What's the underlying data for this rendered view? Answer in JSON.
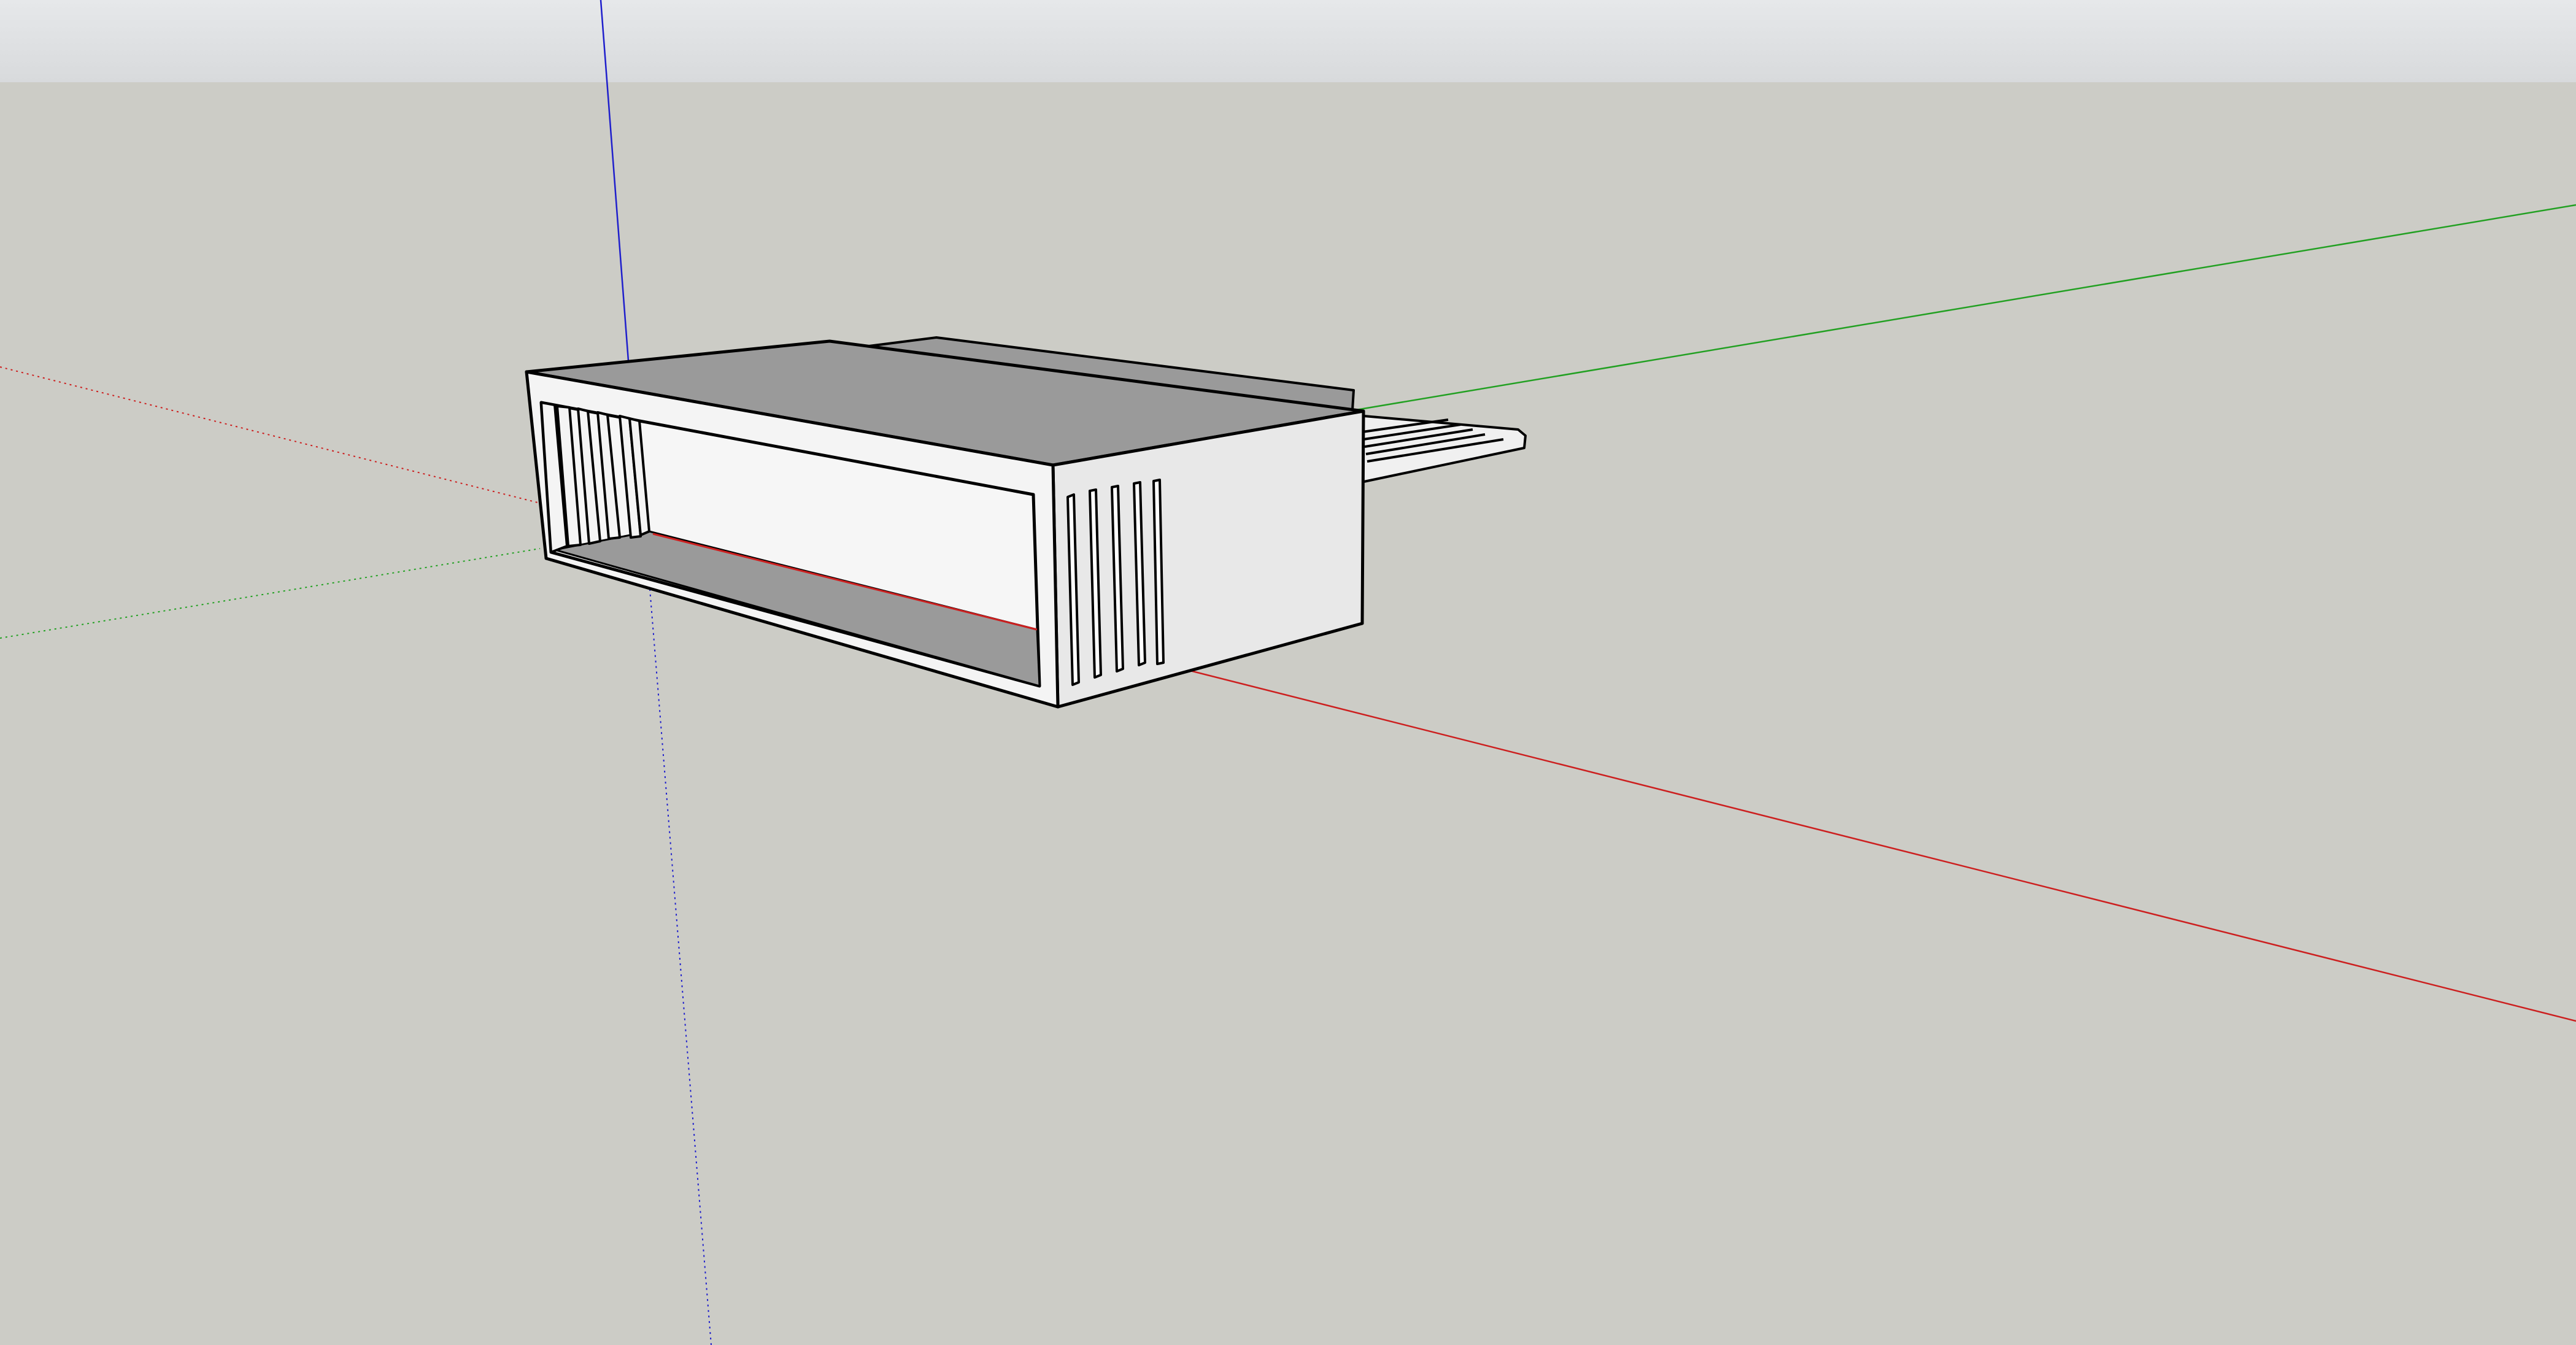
{
  "app": {
    "type": "3d-modeling-viewport"
  },
  "scene": {
    "sky_color": "#e2e4e6",
    "ground_color": "#ccccc6",
    "axes": {
      "red": "#cc1f1f",
      "green": "#22a022",
      "blue": "#1f1fcc"
    },
    "model": {
      "description_icon": "cube-icon",
      "face_colors": {
        "top": "#9a9a9a",
        "front": "#f4f4f4",
        "side": "#e8e8e8",
        "inner_bottom": "#9a9a9a",
        "edge": "#000000"
      }
    }
  }
}
